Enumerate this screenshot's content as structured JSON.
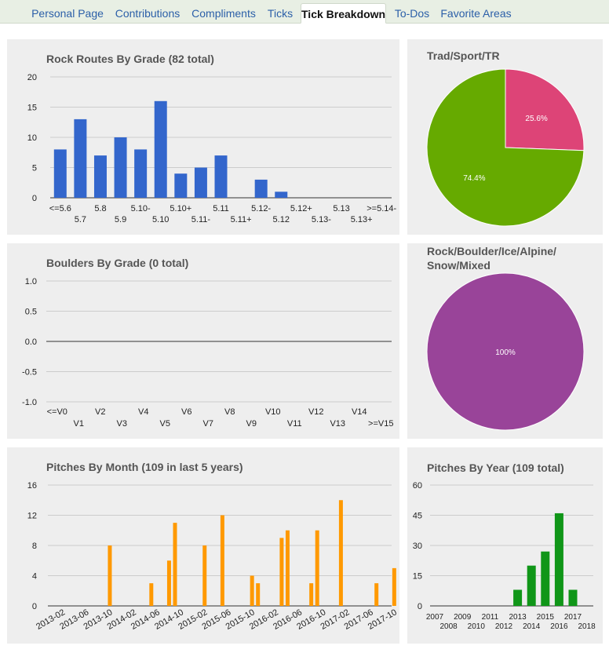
{
  "tabs": [
    {
      "label": "Personal Page",
      "active": false
    },
    {
      "label": "Contributions",
      "active": false
    },
    {
      "label": "Compliments",
      "active": false
    },
    {
      "label": "Ticks",
      "active": false
    },
    {
      "label": "Tick Breakdown",
      "active": true
    },
    {
      "label": "To-Dos",
      "active": false
    },
    {
      "label": "Favorite Areas",
      "active": false
    }
  ],
  "colors": {
    "rock_bar": "#3366cc",
    "pitch_month_bar": "#ff9900",
    "pitch_year_bar": "#109618",
    "pie_green": "#66aa00",
    "pie_pink": "#dd4477",
    "pie_purple": "#994499"
  },
  "chart_data": [
    {
      "id": "rock",
      "type": "bar",
      "title": "Rock Routes By Grade (82 total)",
      "categories": [
        "<=5.6",
        "5.7",
        "5.8",
        "5.9",
        "5.10-",
        "5.10",
        "5.10+",
        "5.11-",
        "5.11",
        "5.11+",
        "5.12-",
        "5.12",
        "5.12+",
        "5.13-",
        "5.13",
        "5.13+",
        ">=5.14-"
      ],
      "values": [
        8,
        13,
        7,
        10,
        8,
        16,
        4,
        5,
        7,
        0,
        3,
        1,
        0,
        0,
        0,
        0,
        0
      ],
      "yticks": [
        "0",
        "5",
        "10",
        "15",
        "20"
      ],
      "ylim": [
        0,
        20
      ],
      "grid": true
    },
    {
      "id": "pie1",
      "type": "pie",
      "title": "Trad/Sport/TR",
      "slices": [
        {
          "value": 25.6,
          "label": "25.6%",
          "color": "#dd4477"
        },
        {
          "value": 74.4,
          "label": "74.4%",
          "color": "#66aa00"
        }
      ]
    },
    {
      "id": "boulder",
      "type": "bar",
      "title": "Boulders By Grade (0 total)",
      "categories": [
        "<=V0",
        "V1",
        "V2",
        "V3",
        "V4",
        "V5",
        "V6",
        "V7",
        "V8",
        "V9",
        "V10",
        "V11",
        "V12",
        "V13",
        "V14",
        ">=V15"
      ],
      "values": [
        0,
        0,
        0,
        0,
        0,
        0,
        0,
        0,
        0,
        0,
        0,
        0,
        0,
        0,
        0,
        0
      ],
      "yticks": [
        "1.0",
        "0.5",
        "0.0",
        "-0.5",
        "-1.0"
      ],
      "ylim": [
        -1,
        1
      ],
      "grid": true
    },
    {
      "id": "pie2",
      "type": "pie",
      "title_lines": [
        "Rock/Boulder/Ice/Alpine/",
        "Snow/Mixed"
      ],
      "slices": [
        {
          "value": 100,
          "label": "100%",
          "color": "#994499"
        }
      ]
    },
    {
      "id": "month",
      "type": "bar",
      "title": "Pitches By Month (109 in last 5 years)",
      "xticks": [
        "2013-02",
        "2013-06",
        "2013-10",
        "2014-02",
        "2014-06",
        "2014-10",
        "2015-02",
        "2015-06",
        "2015-10",
        "2016-02",
        "2016-06",
        "2016-10",
        "2017-02",
        "2017-06",
        "2017-10"
      ],
      "bars": [
        {
          "month": "2013-10",
          "value": 8
        },
        {
          "month": "2014-05",
          "value": 3
        },
        {
          "month": "2014-08",
          "value": 6
        },
        {
          "month": "2014-09",
          "value": 11
        },
        {
          "month": "2015-02",
          "value": 8
        },
        {
          "month": "2015-05",
          "value": 12
        },
        {
          "month": "2015-10",
          "value": 4
        },
        {
          "month": "2015-11",
          "value": 3
        },
        {
          "month": "2016-03",
          "value": 9
        },
        {
          "month": "2016-04",
          "value": 10
        },
        {
          "month": "2016-08",
          "value": 3
        },
        {
          "month": "2016-09",
          "value": 10
        },
        {
          "month": "2017-01",
          "value": 14
        },
        {
          "month": "2017-07",
          "value": 3
        },
        {
          "month": "2017-10",
          "value": 5
        }
      ],
      "yticks": [
        "0",
        "4",
        "8",
        "12",
        "16"
      ],
      "ylim": [
        0,
        16
      ],
      "grid": true
    },
    {
      "id": "year",
      "type": "bar",
      "title": "Pitches By Year (109 total)",
      "xticks_top": [
        "2007",
        "2009",
        "2011",
        "2013",
        "2015",
        "2017"
      ],
      "xticks_bottom": [
        "2008",
        "2010",
        "2012",
        "2014",
        "2016",
        "2018"
      ],
      "bars": [
        {
          "year": 2013,
          "value": 8
        },
        {
          "year": 2014,
          "value": 20
        },
        {
          "year": 2015,
          "value": 27
        },
        {
          "year": 2016,
          "value": 46
        },
        {
          "year": 2017,
          "value": 8
        }
      ],
      "yticks": [
        "0",
        "15",
        "30",
        "45",
        "60"
      ],
      "ylim": [
        0,
        60
      ],
      "grid": true
    }
  ]
}
